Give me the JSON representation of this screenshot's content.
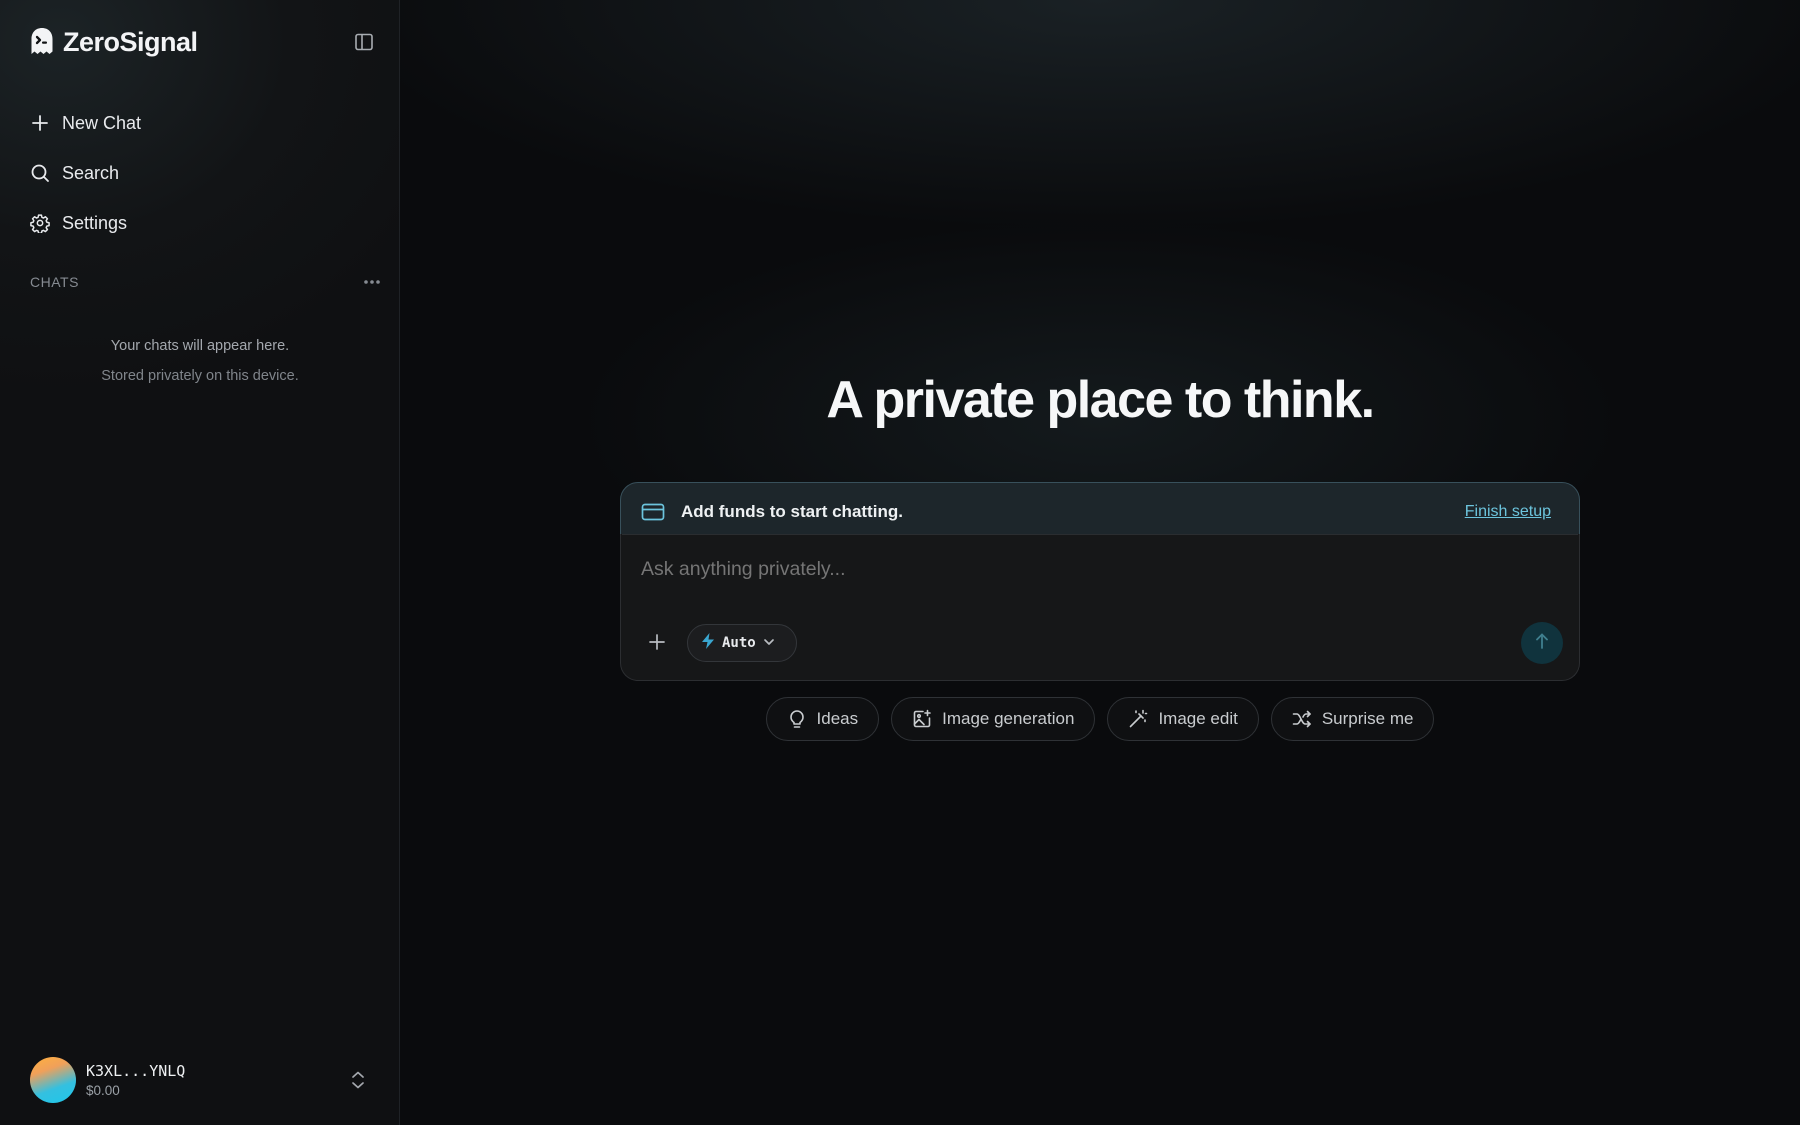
{
  "app": {
    "name": "ZeroSignal",
    "accent": "#6cc4dd"
  },
  "sidebar": {
    "collapse_icon": "sidebar-toggle-icon",
    "items": [
      {
        "label": "New Chat",
        "icon": "plus-icon"
      },
      {
        "label": "Search",
        "icon": "search-icon"
      },
      {
        "label": "Settings",
        "icon": "gear-icon"
      }
    ],
    "chats_label": "CHATS",
    "empty_line1": "Your chats will appear here.",
    "empty_line2": "Stored privately on this device.",
    "account": {
      "id": "K3XL...YNLQ",
      "balance": "$0.00"
    }
  },
  "main": {
    "headline": "A private place to think.",
    "banner": {
      "message": "Add funds to start chatting.",
      "action": "Finish setup",
      "icon": "credit-card-icon"
    },
    "composer": {
      "placeholder": "Ask anything privately...",
      "model": "Auto",
      "model_icon": "lightning-icon",
      "send_icon": "arrow-up-icon"
    },
    "suggestions": [
      {
        "label": "Ideas",
        "icon": "lightbulb-icon"
      },
      {
        "label": "Image generation",
        "icon": "image-sparkle-icon"
      },
      {
        "label": "Image edit",
        "icon": "magic-wand-icon"
      },
      {
        "label": "Surprise me",
        "icon": "shuffle-icon"
      }
    ]
  }
}
